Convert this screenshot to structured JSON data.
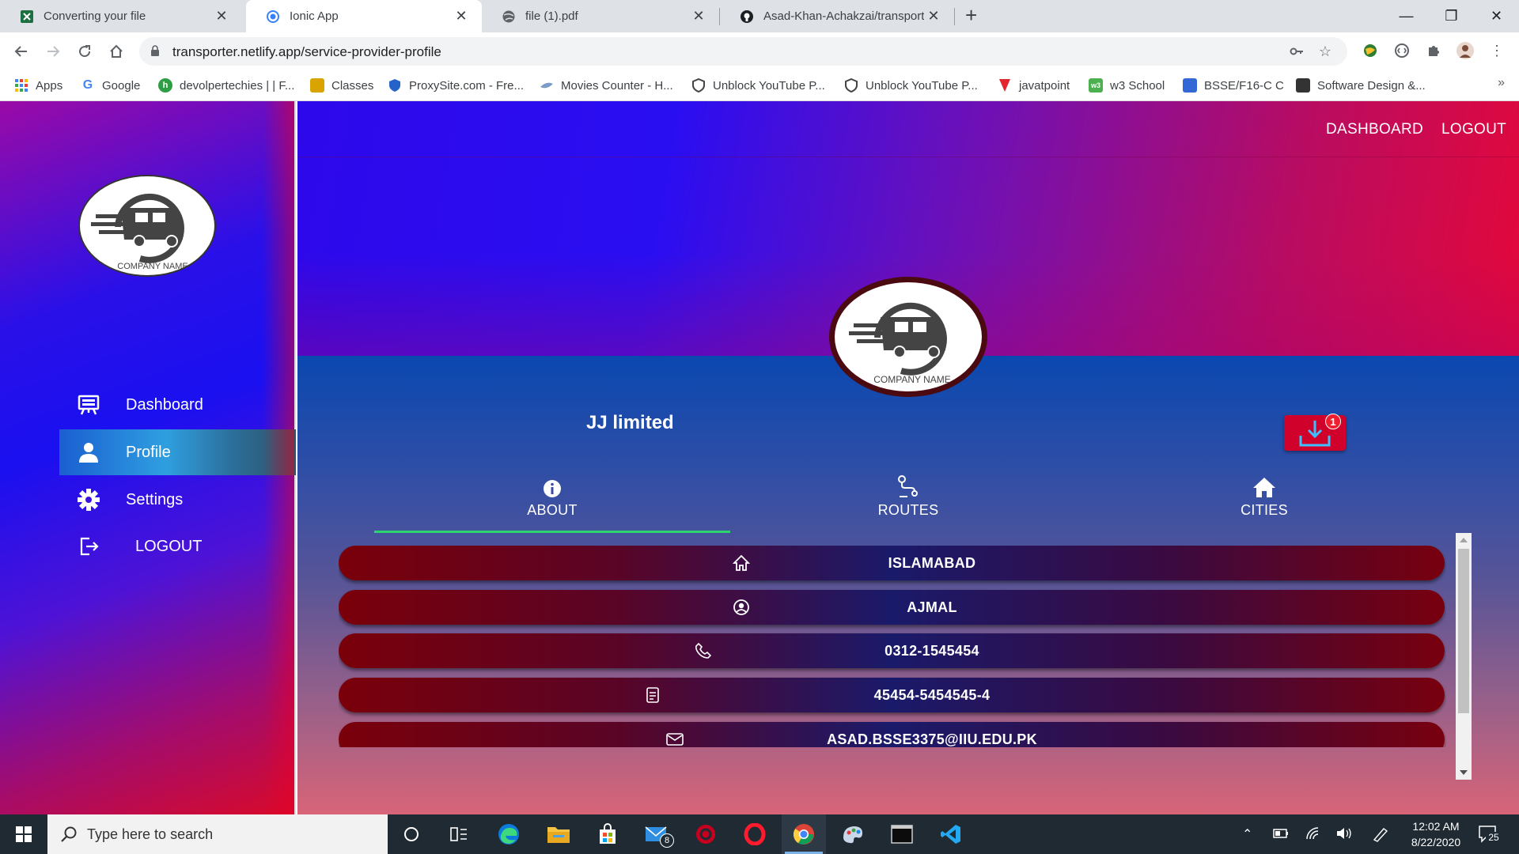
{
  "browser": {
    "tabs": [
      {
        "title": "Converting your file",
        "icon": "excel-icon",
        "active": false
      },
      {
        "title": "Ionic App",
        "icon": "ionic-icon",
        "active": true
      },
      {
        "title": "file (1).pdf",
        "icon": "globe-icon",
        "active": false
      },
      {
        "title": "Asad-Khan-Achakzai/transport-s",
        "icon": "github-icon",
        "active": false
      }
    ],
    "url": "transporter.netlify.app/service-provider-profile",
    "bookmarks": [
      {
        "label": "Apps",
        "icon": "apps-grid-icon",
        "color": "#4285f4"
      },
      {
        "label": "Google",
        "icon": "google-icon",
        "color": "#4285f4"
      },
      {
        "label": "devolpertechies | | F...",
        "icon": "devolpertechies-icon",
        "color": "#2e9e44"
      },
      {
        "label": "Classes",
        "icon": "classroom-icon",
        "color": "#d9a400"
      },
      {
        "label": "ProxySite.com - Fre...",
        "icon": "shield-icon",
        "color": "#2563c9"
      },
      {
        "label": "Movies Counter - H...",
        "icon": "movie-icon",
        "color": "#7a9cc6"
      },
      {
        "label": "Unblock YouTube P...",
        "icon": "shield-icon",
        "color": "#444444"
      },
      {
        "label": "Unblock YouTube P...",
        "icon": "shield-icon",
        "color": "#444444"
      },
      {
        "label": "javatpoint",
        "icon": "javatpoint-icon",
        "color": "#e3262d"
      },
      {
        "label": "w3 School",
        "icon": "w3-icon",
        "color": "#4caf50"
      },
      {
        "label": "BSSE/F16-C C",
        "icon": "person-icon",
        "color": "#3367d6"
      },
      {
        "label": "Software Design &...",
        "icon": "folder-icon",
        "color": "#333333"
      }
    ]
  },
  "app": {
    "nav_links": {
      "dashboard": "DASHBOARD",
      "logout": "LOGOUT"
    },
    "logo_text": "COMPANY NAME",
    "sidebar": {
      "items": [
        {
          "label": "Dashboard",
          "icon": "easel-icon",
          "active": false
        },
        {
          "label": "Profile",
          "icon": "person-icon",
          "active": true
        },
        {
          "label": "Settings",
          "icon": "gear-icon",
          "active": false
        },
        {
          "label": "LOGOUT",
          "icon": "logout-icon",
          "active": false
        }
      ]
    },
    "profile": {
      "company_name": "JJ limited",
      "download_badge": "1",
      "tabs": [
        {
          "label": "ABOUT",
          "icon": "info-icon",
          "selected": true
        },
        {
          "label": "ROUTES",
          "icon": "route-icon",
          "selected": false
        },
        {
          "label": "CITIES",
          "icon": "home-icon",
          "selected": false
        }
      ],
      "details": [
        {
          "icon": "home-outline-icon",
          "value": "ISLAMABAD"
        },
        {
          "icon": "person-circle-icon",
          "value": "AJMAL"
        },
        {
          "icon": "phone-icon",
          "value": "0312-1545454"
        },
        {
          "icon": "document-icon",
          "value": "45454-5454545-4"
        },
        {
          "icon": "mail-icon",
          "value": "ASAD.BSSE3375@IIU.EDU.PK"
        }
      ]
    }
  },
  "taskbar": {
    "search_placeholder": "Type here to search",
    "mail_badge": "8",
    "time": "12:02 AM",
    "date": "8/22/2020",
    "notification_count": "25"
  }
}
